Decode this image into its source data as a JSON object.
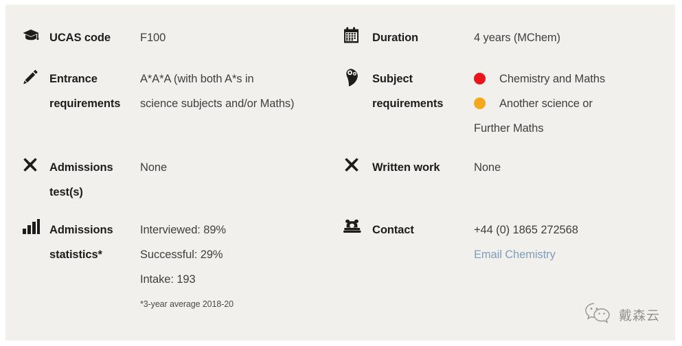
{
  "panel": {
    "background_color": "#f1f0ec",
    "page_background_color": "#ffffff"
  },
  "colors": {
    "label_text": "#1d1d1b",
    "value_text": "#3f3f3e",
    "link": "#7f9db9",
    "bullet_red": "#e9151b",
    "bullet_amber": "#f4a81d"
  },
  "facts": {
    "ucas_code": {
      "icon": "graduation-cap-icon",
      "label": "UCAS code",
      "value": "F100"
    },
    "entrance_requirements": {
      "icon": "pencil-icon",
      "label_line1": "Entrance",
      "label_line2": "requirements",
      "value_line1": "A*A*A (with both A*s in",
      "value_line2": "science subjects and/or Maths)"
    },
    "admissions_tests": {
      "icon": "cross-icon",
      "label_line1": "Admissions",
      "label_line2": "test(s)",
      "value": "None"
    },
    "admissions_statistics": {
      "icon": "bar-chart-icon",
      "label_line1": "Admissions",
      "label_line2": "statistics*",
      "value_line1": "Interviewed: 89%",
      "value_line2": "Successful: 29%",
      "value_line3": "Intake: 193",
      "footnote": "*3-year average 2018-20"
    },
    "duration": {
      "icon": "calendar-icon",
      "label": "Duration",
      "value": "4 years (MChem)"
    },
    "subject_requirements": {
      "icon": "brain-icon",
      "label_line1": "Subject",
      "label_line2": "requirements",
      "bullets": [
        {
          "color": "red",
          "text": "Chemistry and Maths"
        },
        {
          "color": "amber",
          "text": "Another science or"
        }
      ],
      "bullet_continuation": "Further Maths"
    },
    "written_work": {
      "icon": "cross-icon",
      "label": "Written work",
      "value": "None"
    },
    "contact": {
      "icon": "telephone-icon",
      "label": "Contact",
      "phone": "+44 (0) 1865 272568",
      "email_link_text": "Email Chemistry"
    }
  },
  "watermark": {
    "icon": "wechat-icon",
    "text": "戴森云"
  }
}
